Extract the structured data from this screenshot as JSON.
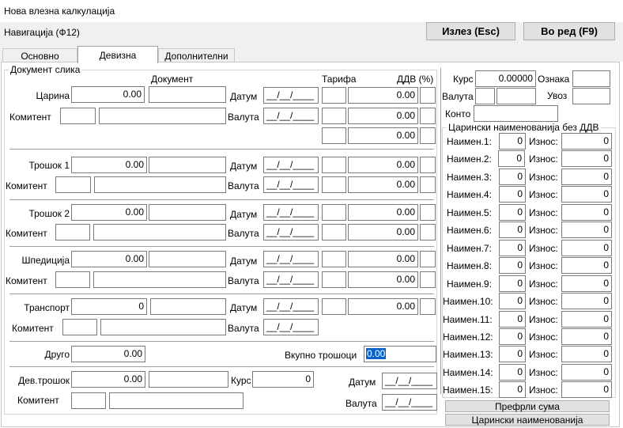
{
  "window_title": "Нова влезна калкулација",
  "navigation_label": "Навигација (Ф12)",
  "buttons": {
    "exit": "Излез (Esc)",
    "ok": "Во ред (F9)",
    "transfer_sum": "Префрли сума",
    "customs_names": "Царински наименованија"
  },
  "tabs": [
    "Основно",
    "Девизна",
    "Дополнителни"
  ],
  "active_tab": "Девизна",
  "doc": {
    "group_title": "Документ слика",
    "col_document": "Документ",
    "col_tariff": "Тарифа",
    "col_vat": "ДДВ (%)",
    "label_date": "Датум",
    "label_currency": "Валута",
    "label_komitent": "Комитент",
    "date_placeholder": "__/__/____",
    "customs_label": "Царина",
    "customs_value": "0.00",
    "customs_vat_rows": [
      "0.00",
      "0.00",
      "0.00"
    ],
    "cost1_label": "Трошок 1",
    "cost1_value": "0.00",
    "cost1_vat_rows": [
      "0.00",
      "0.00"
    ],
    "cost2_label": "Трошок 2",
    "cost2_value": "0.00",
    "cost2_vat_rows": [
      "0.00",
      "0.00"
    ],
    "spedition_label": "Шпедиција",
    "spedition_value": "0.00",
    "spedition_vat_rows": [
      "0.00",
      "0.00"
    ],
    "transport_label": "Транспорт",
    "transport_value": "0",
    "transport_vat": "0.00",
    "other_label": "Друго",
    "other_value": "0.00",
    "total_label": "Вкупно трошоци",
    "total_value": "0.00",
    "devcost_label": "Дев.трошок",
    "devcost_value": "0.00",
    "rate_label": "Курс",
    "rate_value": "0"
  },
  "right": {
    "rate_label": "Курс",
    "rate_value": "0.00000",
    "mark_label": "Ознака",
    "currency_label": "Валута",
    "import_label": "Увоз",
    "konto_label": "Конто",
    "group_title": "Царински наименованија без ДДВ",
    "amount_label": "Износ:",
    "rows": [
      {
        "name": "Наимен.1:",
        "qty": "0",
        "amount": "0"
      },
      {
        "name": "Наимен.2:",
        "qty": "0",
        "amount": "0"
      },
      {
        "name": "Наимен.3:",
        "qty": "0",
        "amount": "0"
      },
      {
        "name": "Наимен.4:",
        "qty": "0",
        "amount": "0"
      },
      {
        "name": "Наимен.5:",
        "qty": "0",
        "amount": "0"
      },
      {
        "name": "Наимен.6:",
        "qty": "0",
        "amount": "0"
      },
      {
        "name": "Наимен.7:",
        "qty": "0",
        "amount": "0"
      },
      {
        "name": "Наимен.8:",
        "qty": "0",
        "amount": "0"
      },
      {
        "name": "Наимен.9:",
        "qty": "0",
        "amount": "0"
      },
      {
        "name": "Наимен.10:",
        "qty": "0",
        "amount": "0"
      },
      {
        "name": "Наимен.11:",
        "qty": "0",
        "amount": "0"
      },
      {
        "name": "Наимен.12:",
        "qty": "0",
        "amount": "0"
      },
      {
        "name": "Наимен.13:",
        "qty": "0",
        "amount": "0"
      },
      {
        "name": "Наимен.14:",
        "qty": "0",
        "amount": "0"
      },
      {
        "name": "Наимен.15:",
        "qty": "0",
        "amount": "0"
      }
    ]
  }
}
